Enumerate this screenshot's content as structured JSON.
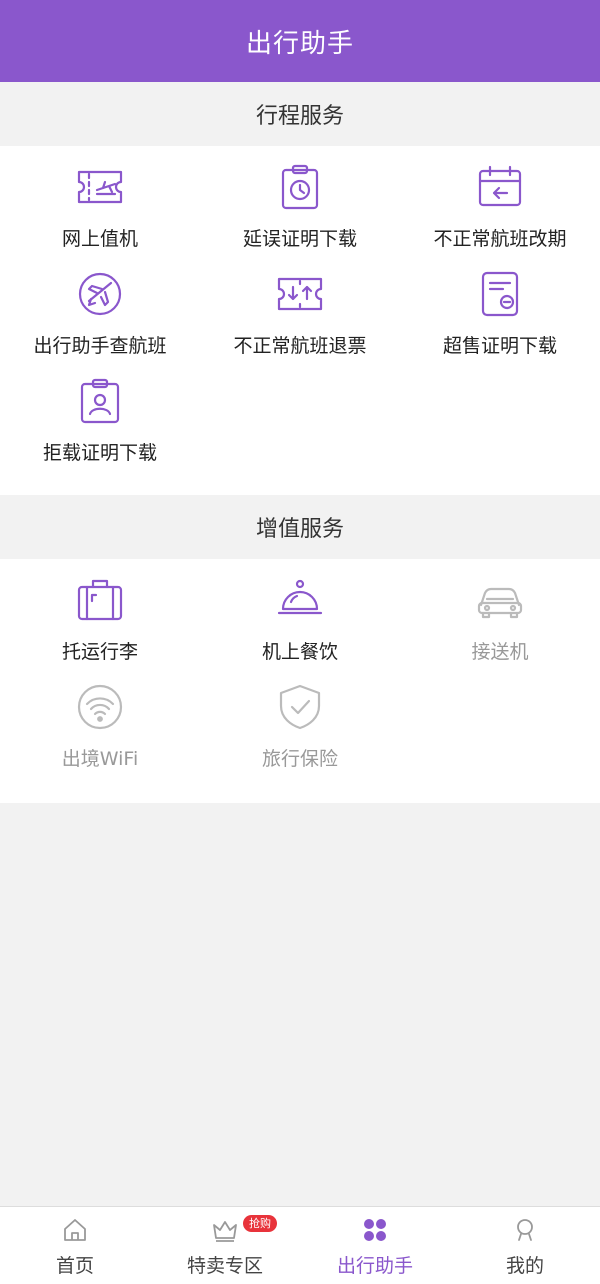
{
  "header": {
    "title": "出行助手"
  },
  "sections": [
    {
      "title": "行程服务",
      "items": [
        {
          "label": "网上值机",
          "icon": "boarding-pass-icon"
        },
        {
          "label": "延误证明下载",
          "icon": "clock-clipboard-icon"
        },
        {
          "label": "不正常航班改期",
          "icon": "calendar-arrow-icon"
        },
        {
          "label": "出行助手查航班",
          "icon": "plane-search-icon"
        },
        {
          "label": "不正常航班退票",
          "icon": "ticket-refund-icon"
        },
        {
          "label": "超售证明下载",
          "icon": "oversold-document-icon"
        },
        {
          "label": "拒载证明下载",
          "icon": "person-clipboard-icon"
        }
      ]
    },
    {
      "title": "增值服务",
      "items": [
        {
          "label": "托运行李",
          "icon": "luggage-icon"
        },
        {
          "label": "机上餐饮",
          "icon": "meal-cloche-icon"
        },
        {
          "label": "接送机",
          "icon": "car-icon"
        },
        {
          "label": "出境WiFi",
          "icon": "wifi-icon"
        },
        {
          "label": "旅行保险",
          "icon": "shield-check-icon"
        }
      ]
    }
  ],
  "tabbar": {
    "items": [
      {
        "label": "首页",
        "icon": "home-icon"
      },
      {
        "label": "特卖专区",
        "icon": "crown-icon",
        "badge": "抢购"
      },
      {
        "label": "出行助手",
        "icon": "grid-dots-icon"
      },
      {
        "label": "我的",
        "icon": "user-icon"
      }
    ]
  },
  "colors": {
    "brand": "#8a57cc",
    "disabled_icon": "#bbbbbb",
    "badge": "#e8333b"
  }
}
